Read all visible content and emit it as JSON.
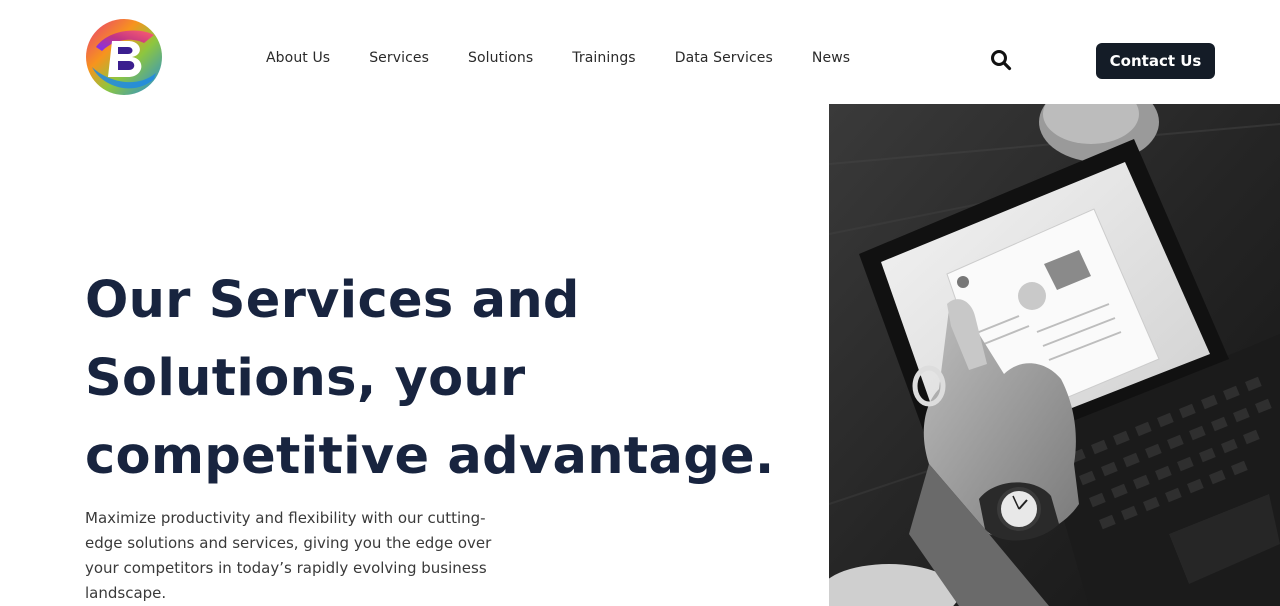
{
  "header": {
    "logo_icon": "brand-b-logo-icon",
    "nav": [
      {
        "label": "About Us"
      },
      {
        "label": "Services"
      },
      {
        "label": "Solutions"
      },
      {
        "label": "Trainings"
      },
      {
        "label": "Data Services"
      },
      {
        "label": "News"
      }
    ],
    "search_icon": "search-icon",
    "contact_label": "Contact Us"
  },
  "hero": {
    "title_lines": [
      "Our Services and",
      "Solutions, your",
      "competitive advantage."
    ],
    "description": "Maximize productivity and flexibility with our cutting-edge solutions and services, giving you the edge over your competitors in today’s rapidly evolving business landscape.",
    "image_icon": "tablet-photo-image"
  },
  "colors": {
    "heading": "#18243f",
    "button_bg": "#141c27",
    "button_text": "#ffffff"
  }
}
